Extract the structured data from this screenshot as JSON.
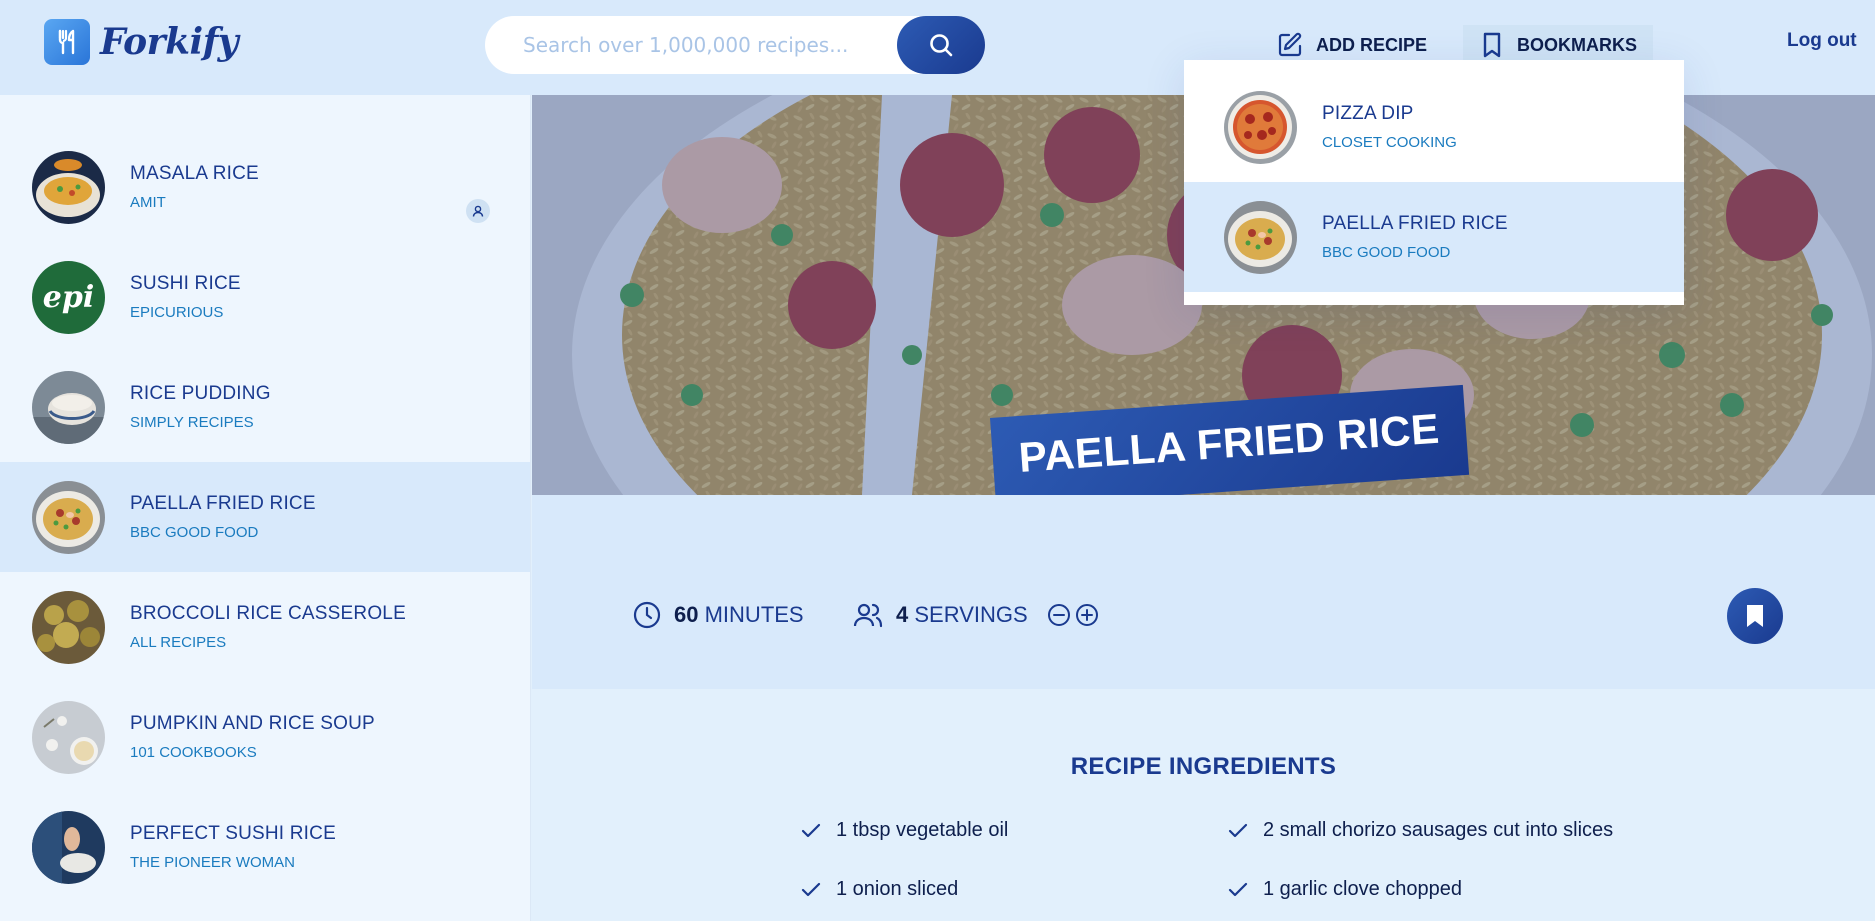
{
  "app": {
    "name": "Forkify"
  },
  "search": {
    "placeholder": "Search over 1,000,000 recipes..."
  },
  "nav": {
    "add_recipe": "ADD RECIPE",
    "bookmarks": "BOOKMARKS",
    "logout": "Log out"
  },
  "results": [
    {
      "title": "MASALA RICE",
      "publisher": "AMIT",
      "user_generated": true
    },
    {
      "title": "SUSHI RICE",
      "publisher": "EPICURIOUS",
      "thumb_text": "epi"
    },
    {
      "title": "RICE PUDDING",
      "publisher": "SIMPLY RECIPES"
    },
    {
      "title": "PAELLA FRIED RICE",
      "publisher": "BBC GOOD FOOD",
      "active": true
    },
    {
      "title": "BROCCOLI RICE CASSEROLE",
      "publisher": "ALL RECIPES"
    },
    {
      "title": "PUMPKIN AND RICE SOUP",
      "publisher": "101 COOKBOOKS"
    },
    {
      "title": "PERFECT SUSHI RICE",
      "publisher": "THE PIONEER WOMAN"
    }
  ],
  "bookmarks": [
    {
      "title": "PIZZA DIP",
      "publisher": "CLOSET COOKING"
    },
    {
      "title": "PAELLA FRIED RICE",
      "publisher": "BBC GOOD FOOD",
      "active": true
    }
  ],
  "recipe": {
    "title": "PAELLA FRIED RICE",
    "cooking_time": "60",
    "cooking_time_unit": "MINUTES",
    "servings": "4",
    "servings_unit": "SERVINGS",
    "bookmarked": true,
    "ingredients_heading": "RECIPE INGREDIENTS",
    "ingredients": [
      "1 tbsp vegetable oil",
      "2 small chorizo sausages cut into slices",
      "1 onion sliced",
      "1 garlic clove chopped"
    ]
  },
  "colors": {
    "primary": "#1a3a8f",
    "accent": "#1a7bbf",
    "header_bg": "#d8e9fb",
    "sidebar_bg": "#eef6fe"
  }
}
